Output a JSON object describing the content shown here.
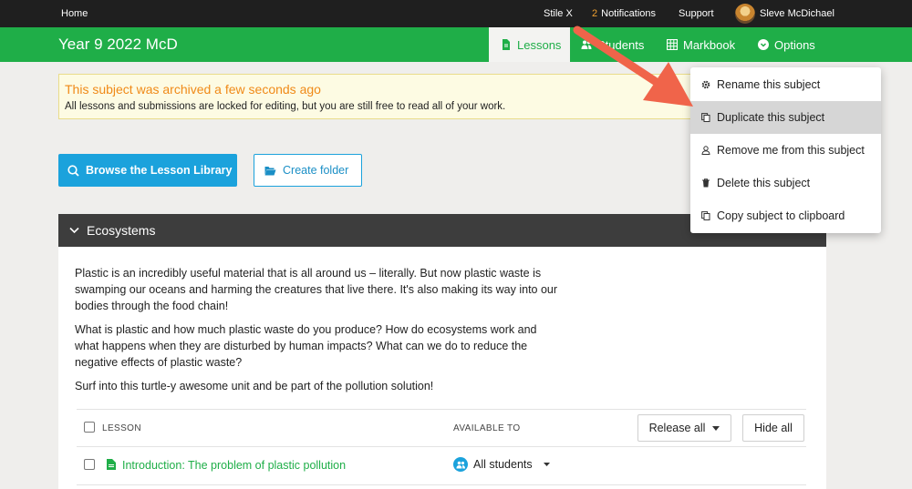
{
  "topnav": {
    "home": "Home",
    "school": "Stile X",
    "notifications_count": "2",
    "notifications_label": "Notifications",
    "support": "Support",
    "user_name": "Sleve McDichael"
  },
  "subject": {
    "title": "Year 9 2022 McD",
    "tabs": [
      {
        "label": "Lessons",
        "icon": "document-icon",
        "active": true
      },
      {
        "label": "Students",
        "icon": "people-icon"
      },
      {
        "label": "Markbook",
        "icon": "grid-icon"
      },
      {
        "label": "Options",
        "icon": "chevron-down-circle-icon"
      }
    ]
  },
  "banner": {
    "heading": "This subject was archived a few seconds ago",
    "body": "All lessons and submissions are locked for editing, but you are still free to read all of your work."
  },
  "actions": {
    "browse": "Browse the Lesson Library",
    "create_folder": "Create folder"
  },
  "folder": {
    "name": "Ecosystems",
    "paragraphs": [
      "Plastic is an incredibly useful material that is all around us – literally. But now plastic waste is swamping our oceans and harming the creatures that live there. It's also making its way into our bodies through the food chain!",
      "What is plastic and how much plastic waste do you produce? How do ecosystems work and what happens when they are disturbed by human impacts? What can we do to reduce the negative effects of plastic waste?",
      "Surf into this turtle-y awesome unit and be part of the pollution solution!"
    ],
    "table": {
      "col_lesson": "LESSON",
      "col_available": "AVAILABLE TO",
      "release_all": "Release all",
      "hide_all": "Hide all",
      "rows": [
        {
          "lesson": "Introduction: The problem of plastic pollution",
          "available": "All students"
        }
      ]
    }
  },
  "options_menu": {
    "items": [
      {
        "label": "Rename this subject",
        "icon": "gear-icon"
      },
      {
        "label": "Duplicate this subject",
        "icon": "copy-icon",
        "highlighted": true
      },
      {
        "label": "Remove me from this subject",
        "icon": "person-icon"
      },
      {
        "label": "Delete this subject",
        "icon": "trash-icon"
      },
      {
        "label": "Copy subject to clipboard",
        "icon": "clipboard-icon"
      }
    ]
  },
  "colors": {
    "brand_green": "#1fae48",
    "accent_blue": "#1ba2dc",
    "warning_orange": "#f08a18",
    "annotation_arrow": "#f0644a"
  }
}
